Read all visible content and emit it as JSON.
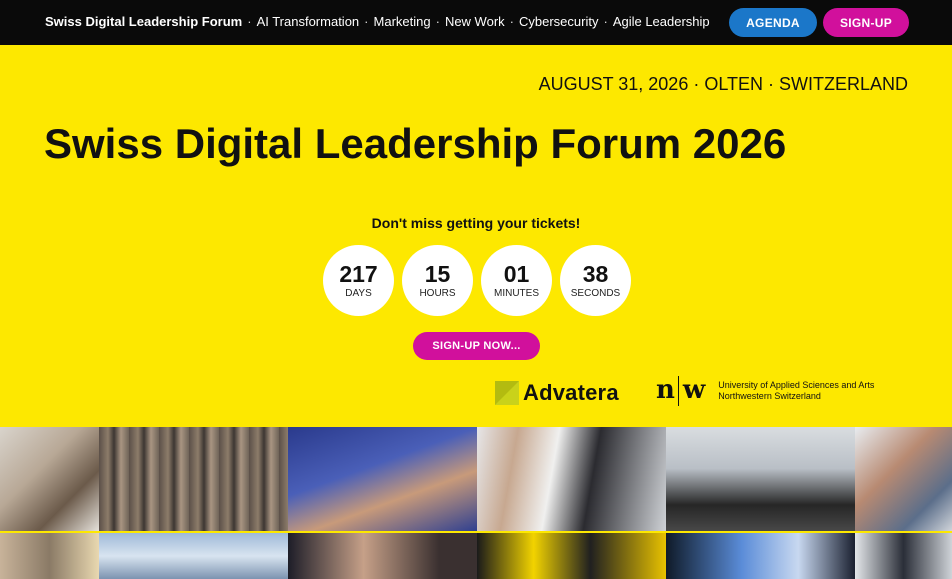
{
  "nav": {
    "brand": "Swiss Digital Leadership Forum",
    "items": [
      "AI Transformation",
      "Marketing",
      "New Work",
      "Cybersecurity",
      "Agile Leadership"
    ],
    "separator": "·",
    "agenda_label": "AGENDA",
    "signup_label": "SIGN-UP"
  },
  "event": {
    "info": "AUGUST 31, 2026 · OLTEN · SWITZERLAND",
    "title": "Swiss Digital Leadership Forum 2026"
  },
  "countdown": {
    "tagline": "Don't miss getting your tickets!",
    "items": [
      {
        "value": "217",
        "label": "DAYS"
      },
      {
        "value": "15",
        "label": "HOURS"
      },
      {
        "value": "01",
        "label": "MINUTES"
      },
      {
        "value": "38",
        "label": "SECONDS"
      }
    ],
    "cta_label": "SIGN-UP NOW..."
  },
  "partners": {
    "advatera": "Advatera",
    "fhnw_mark_left": "n",
    "fhnw_mark_right": "w",
    "fhnw_line1": "University of Applied Sciences and Arts",
    "fhnw_line2": "Northwestern Switzerland"
  },
  "colors": {
    "background": "#fde800",
    "topbar": "#0a0a0a",
    "agenda": "#1b77c9",
    "signup": "#d1109c"
  },
  "photos": [
    "event-photo",
    "crowd-photo",
    "audience-photo",
    "networking-photo",
    "speaker-photo",
    "attendee-photo"
  ]
}
